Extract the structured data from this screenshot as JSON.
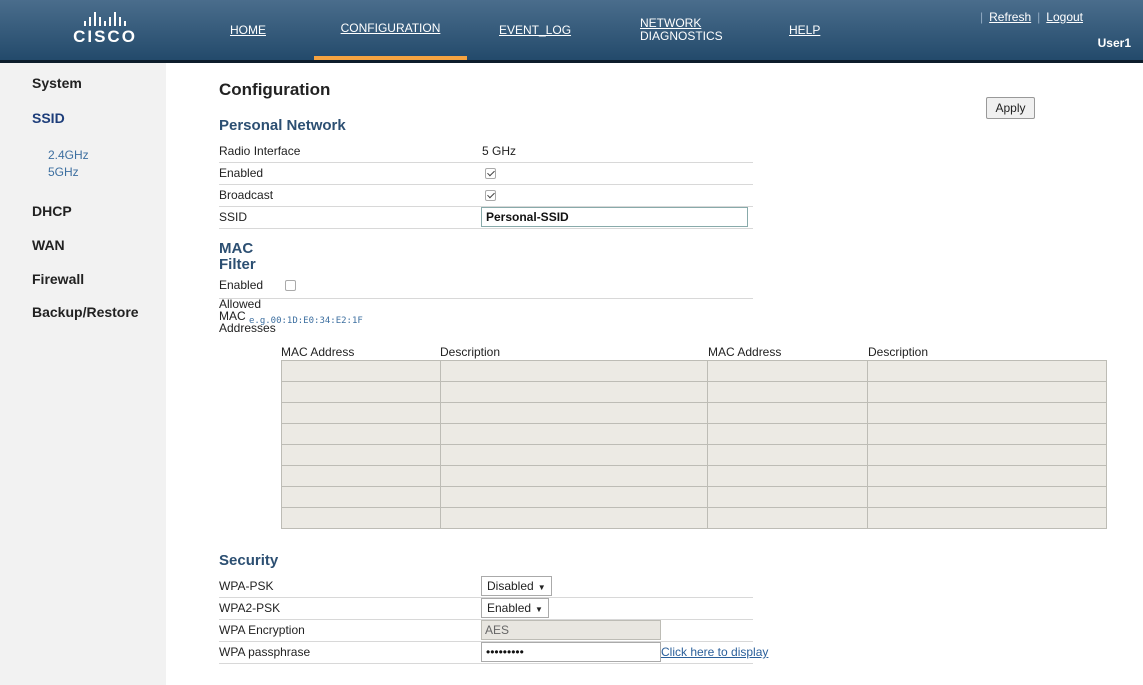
{
  "header": {
    "logo_text": "CISCO",
    "nav": {
      "home": "HOME",
      "configuration": "CONFIGURATION",
      "event_log": "EVENT_LOG",
      "network_diagnostics_1": "NETWORK",
      "network_diagnostics_2": "DIAGNOSTICS",
      "help": "HELP"
    },
    "refresh": "Refresh",
    "logout": "Logout",
    "user": "User1"
  },
  "sidebar": {
    "system": "System",
    "ssid": "SSID",
    "ssid_24": "2.4GHz",
    "ssid_5": "5GHz",
    "dhcp": "DHCP",
    "wan": "WAN",
    "firewall": "Firewall",
    "backup": "Backup/Restore"
  },
  "main": {
    "title": "Configuration",
    "apply": "Apply",
    "personal": {
      "heading": "Personal Network",
      "radio_label": "Radio Interface",
      "radio_value": "5 GHz",
      "enabled_label": "Enabled",
      "broadcast_label": "Broadcast",
      "ssid_label": "SSID",
      "ssid_value": "Personal-SSID"
    },
    "mac": {
      "heading_1": "MAC",
      "heading_2": "Filter",
      "enabled_label": "Enabled",
      "allowed_1": "Allowed",
      "allowed_2": "MAC",
      "allowed_3": "Addresses",
      "hint": "e.g.00:1D:E0:34:E2:1F",
      "col_mac1": "MAC Address",
      "col_desc1": "Description",
      "col_mac2": "MAC Address",
      "col_desc2": "Description"
    },
    "security": {
      "heading": "Security",
      "wpa_psk_label": "WPA-PSK",
      "wpa_psk_value": "Disabled",
      "wpa2_psk_label": "WPA2-PSK",
      "wpa2_psk_value": "Enabled",
      "enc_label": "WPA Encryption",
      "enc_value": "AES",
      "pass_label": "WPA passphrase",
      "pass_value": "•••••••••",
      "display_link": "Click here to display"
    }
  }
}
